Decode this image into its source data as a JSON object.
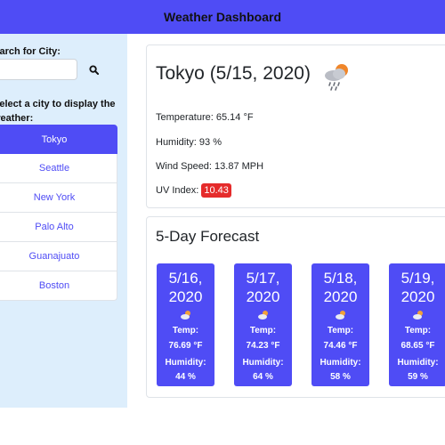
{
  "header": {
    "title": "Weather Dashboard"
  },
  "sidebar": {
    "search_label": "Search for City:",
    "search_value": "",
    "hint": "Select a city to display the weather:",
    "cities": [
      {
        "label": "Tokyo",
        "active": true
      },
      {
        "label": "Seattle"
      },
      {
        "label": "New York"
      },
      {
        "label": "Palo Alto"
      },
      {
        "label": "Guanajuato"
      },
      {
        "label": "Boston"
      }
    ]
  },
  "current": {
    "title": "Tokyo (5/15, 2020)",
    "temperature": "Temperature: 65.14 °F",
    "humidity": "Humidity: 93 %",
    "wind": "Wind Speed: 13.87 MPH",
    "uv_label": "UV Index:",
    "uv_value": "10.43"
  },
  "forecast": {
    "title": "5-Day Forecast",
    "temp_label": "Temp:",
    "humidity_label": "Humidity:",
    "days": [
      {
        "date": "5/16, 2020",
        "temp": "76.69 °F",
        "humidity": "44 %",
        "icon": "sun-cloud-icon"
      },
      {
        "date": "5/17, 2020",
        "temp": "74.23 °F",
        "humidity": "64 %",
        "icon": "sun-cloud-icon"
      },
      {
        "date": "5/18, 2020",
        "temp": "74.46 °F",
        "humidity": "58 %",
        "icon": "sun-cloud-icon"
      },
      {
        "date": "5/19, 2020",
        "temp": "68.65 °F",
        "humidity": "59 %",
        "icon": "sun-cloud-icon"
      }
    ]
  },
  "colors": {
    "accent": "#4f4cf5",
    "sidebar_bg": "#ddeefc",
    "uv_badge": "#e52b2b"
  }
}
